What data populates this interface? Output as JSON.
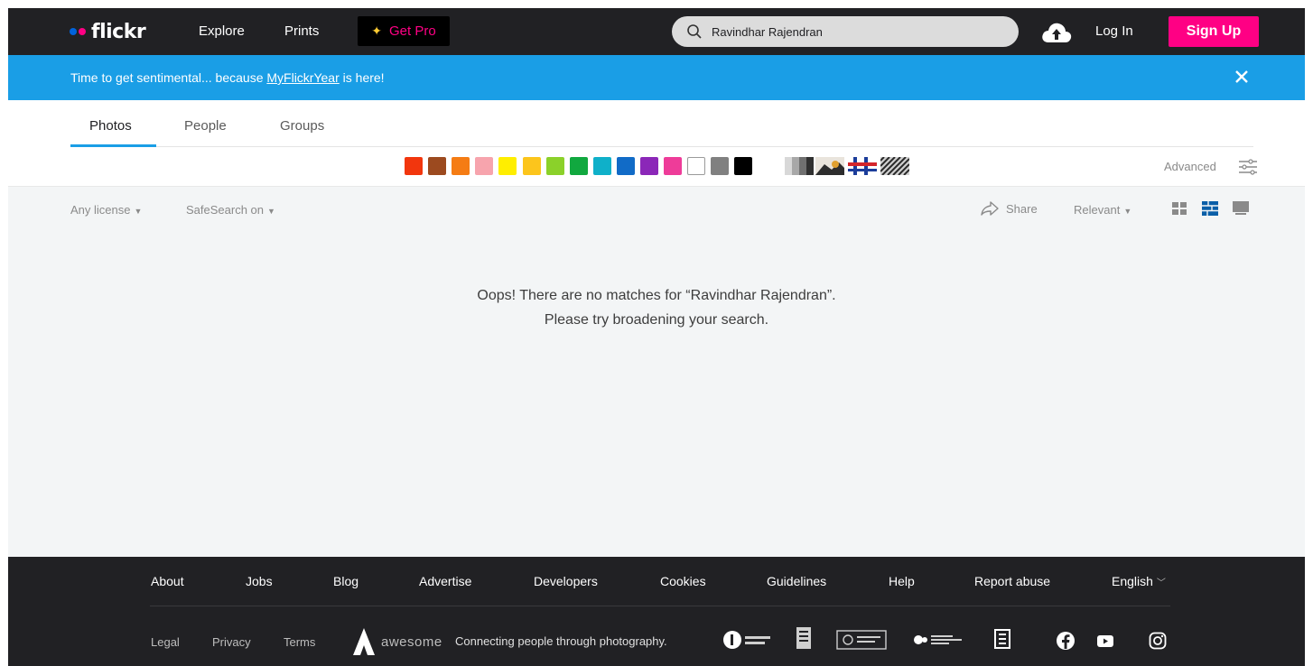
{
  "nav": {
    "logo_text": "flickr",
    "explore": "Explore",
    "prints": "Prints",
    "get_pro": "Get Pro",
    "search_value": "Ravindhar Rajendran",
    "login": "Log In",
    "signup": "Sign Up"
  },
  "banner": {
    "prefix": "Time to get sentimental... because ",
    "link": "MyFlickrYear",
    "suffix": " is here!"
  },
  "tabs": [
    {
      "label": "Photos",
      "active": true
    },
    {
      "label": "People",
      "active": false
    },
    {
      "label": "Groups",
      "active": false
    }
  ],
  "color_swatches": [
    "#f2360d",
    "#9c4a1f",
    "#f57c14",
    "#f7a4ad",
    "#ffee00",
    "#fcc51c",
    "#8bd12a",
    "#11a83f",
    "#0fb0c9",
    "#116bc7",
    "#8b27b8",
    "#ee3c99",
    "#ffffff",
    "#808080",
    "#000000"
  ],
  "filters": {
    "advanced": "Advanced",
    "license": "Any license",
    "safesearch": "SafeSearch on",
    "share": "Share",
    "sort": "Relevant"
  },
  "empty": {
    "line1": "Oops! There are no matches for “Ravindhar Rajendran”.",
    "line2": "Please try broadening your search."
  },
  "footer": {
    "links": [
      "About",
      "Jobs",
      "Blog",
      "Advertise",
      "Developers",
      "Cookies",
      "Guidelines",
      "Help",
      "Report abuse"
    ],
    "language": "English",
    "legal_links": [
      "Legal",
      "Privacy",
      "Terms"
    ],
    "awesome_brand": "awesome",
    "tagline": "Connecting people through photography."
  }
}
